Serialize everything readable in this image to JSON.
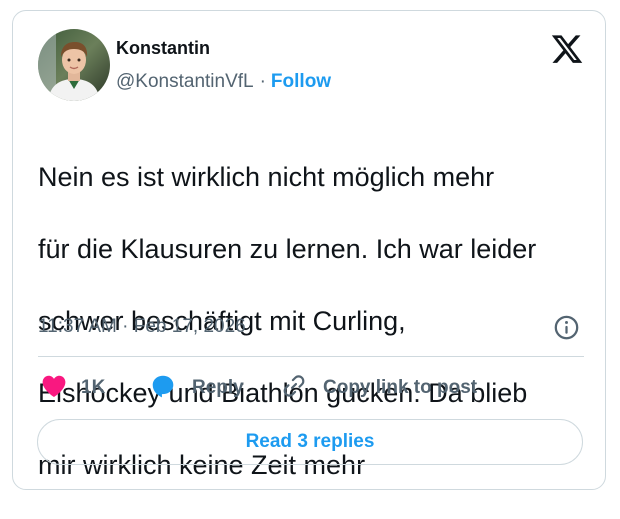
{
  "author": {
    "display_name": "Konstantin",
    "handle": "@KonstantinVfL",
    "separator": "·",
    "follow_label": "Follow"
  },
  "tweet": {
    "text_lines": [
      "Nein es ist wirklich nicht möglich mehr",
      "für die Klausuren zu lernen. Ich war leider",
      "schwer beschäftigt mit Curling,",
      "Eishockey und Biathlon gucken. Da blieb",
      "mir wirklich keine Zeit mehr"
    ],
    "timestamp": "11:37 AM · Feb 17, 2026"
  },
  "actions": {
    "like_count": "1K",
    "reply_label": "Reply",
    "copy_link_label": "Copy link to post"
  },
  "read_replies_label": "Read 3 replies",
  "icons": {
    "brand": "x-logo-icon",
    "info": "info-icon",
    "like": "heart-icon",
    "reply": "speech-bubble-icon",
    "copy": "link-icon"
  },
  "colors": {
    "accent": "#1d9bf0",
    "like": "#f91880",
    "text_primary": "#0f1419",
    "text_secondary": "#536471",
    "border": "#cfd9de"
  }
}
